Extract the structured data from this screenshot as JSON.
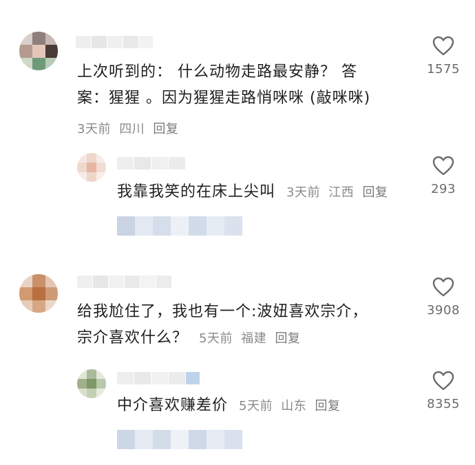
{
  "comments": [
    {
      "text_line1": "上次听到的： 什么动物走路最安静？ 答",
      "text_line2": "案：猩猩 。因为猩猩走路悄咪咪 (敲咪咪)",
      "time": "3天前",
      "location": "四川",
      "reply_label": "回复",
      "likes": "1575",
      "like_icon": "heart-outline-icon"
    },
    {
      "text": "我靠我笑的在床上尖叫",
      "time": "3天前",
      "location": "江西",
      "reply_label": "回复",
      "likes": "293",
      "like_icon": "heart-outline-icon"
    },
    {
      "text_line1": "给我尬住了，我也有一个:波妞喜欢宗介，",
      "text_line2": "宗介喜欢什么？",
      "time": "5天前",
      "location": "福建",
      "reply_label": "回复",
      "likes": "3908",
      "like_icon": "heart-outline-icon"
    },
    {
      "text": "中介喜欢赚差价",
      "time": "5天前",
      "location": "山东",
      "reply_label": "回复",
      "likes": "8355",
      "like_icon": "heart-outline-icon"
    }
  ],
  "colors": {
    "text_primary": "#1f1f1f",
    "text_meta": "#8a8a8a",
    "like_count": "#6a6a6a"
  }
}
